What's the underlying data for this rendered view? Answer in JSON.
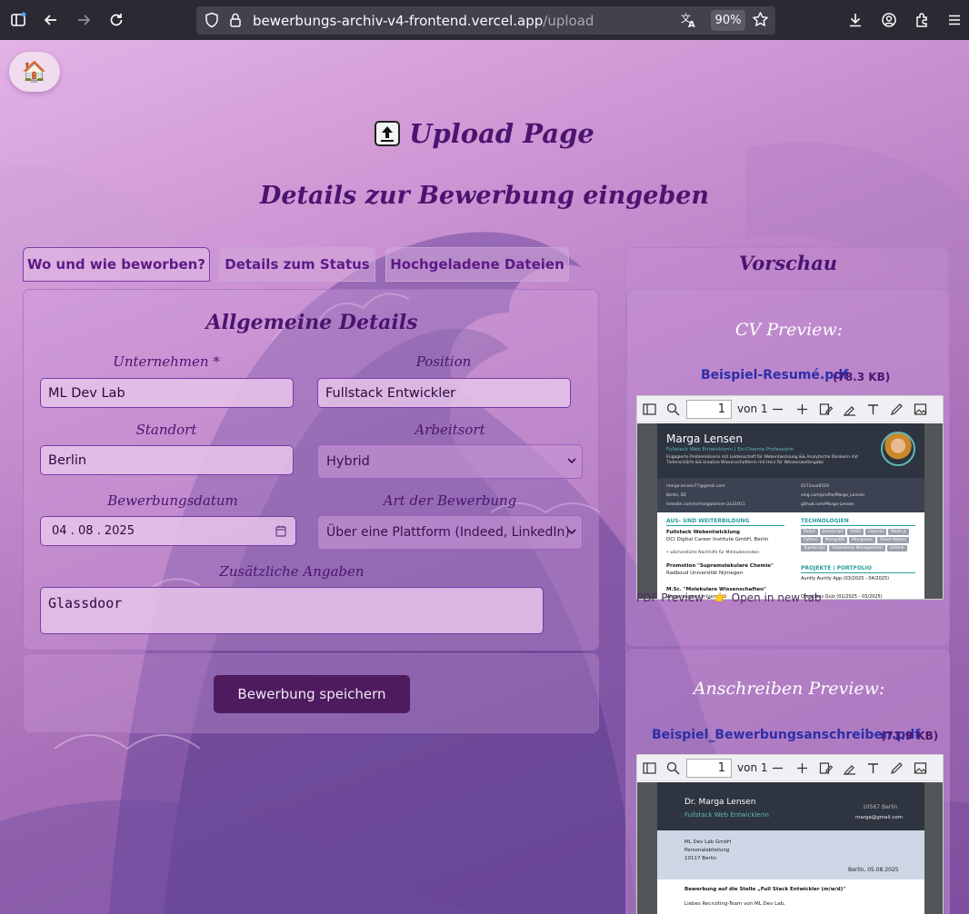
{
  "browser": {
    "url_host": "bewerbungs-archiv-v4-frontend.vercel.app",
    "url_path": "/upload",
    "zoom": "90%"
  },
  "page": {
    "home_icon": "🏠",
    "upload_title": "Upload Page",
    "details_title": "Details zur Bewerbung eingeben"
  },
  "tabs": [
    {
      "label": "Wo und wie beworben?",
      "active": true
    },
    {
      "label": "Details zum Status",
      "active": false
    },
    {
      "label": "Hochgeladene Dateien",
      "active": false
    }
  ],
  "form": {
    "heading": "Allgemeine Details",
    "company_label": "Unternehmen *",
    "company_value": "ML Dev Lab",
    "position_label": "Position",
    "position_value": "Fullstack Entwickler",
    "location_label": "Standort",
    "location_value": "Berlin",
    "worktype_label": "Arbeitsort",
    "worktype_value": "Hybrid",
    "date_label": "Bewerbungsdatum",
    "date_value": "04 . 08 . 2025",
    "apptype_label": "Art der Bewerbung",
    "apptype_value": "Über eine Plattform (Indeed, LinkedIn)",
    "extra_label": "Zusätzliche Angaben",
    "extra_value": "Glassdoor",
    "save_label": "Bewerbung speichern"
  },
  "preview": {
    "title": "Vorschau",
    "cv": {
      "title": "CV Preview:",
      "filename": "Beispiel-Resumé.pdf",
      "size": "(78.3 KB)",
      "page": "1",
      "of_pages": "von 1",
      "note": "PDF Preview - 👉 Open in new tab",
      "doc_name": "Marga Lensen",
      "doc_role": "Fullstack Web Entwicklerin | Ex-Chemie Professorin",
      "doc_tagline_1": "Engagierte Problemlöserin mit Leidenschaft für Webentwicklung && Analytische Denkerin mit",
      "doc_tagline_2": "Tiefenschärfe && kreative Wissenschaftlerin mit Herz für Wissensweitergabe",
      "doc_email": "marga.lensen77@gmail.com",
      "doc_city": "Berlin, DE",
      "doc_linkedin": "linkedin.com/in/margalensen-2a31911",
      "doc_phone": "0172xxx6319",
      "doc_xing": "xing.com/profile/Marga_Lensen",
      "doc_github": "github.com/Marga-Lensen",
      "doc_sec_edu": "AUS- UND WEITERBILDUNG",
      "doc_edu1": "Fullstack Webentwicklung",
      "doc_edu1_org": "DCI Digital Career Institute GmbH, Berlin",
      "doc_edu1_note": "• wöchentliche Nachhilfe für Mitstudierenden",
      "doc_edu2": "Promotion \"Supramolekulare Chemie\"",
      "doc_edu2_org": "Radboud Universität Nijmegen",
      "doc_edu3": "M.Sc. \"Molekulare Wissenschaften\"",
      "doc_edu3_org": "Wageningen Universität",
      "doc_sec_tech": "TECHNOLOGIEN",
      "doc_tech": [
        "React",
        "JavaScript",
        "SASS",
        "express",
        "Node.js",
        "Python",
        "MongoDB",
        "Mongoose",
        "React Native",
        "TypeScript",
        "Datenbank Management",
        "GitHub"
      ],
      "doc_sec_proj": "PROJEKTE | PORTFOLIO",
      "doc_proj1": "Auntly Auntly App (03/2025 - 04/2025)",
      "doc_proj2": "Questions Quiz (01/2025 - 03/2025)"
    },
    "letter": {
      "title": "Anschreiben Preview:",
      "filename": "Beispiel_Bewerbungsanschreiben.pdf",
      "size": "(71.9 KB)",
      "page": "1",
      "of_pages": "von 1",
      "doc_name": "Dr. Marga Lensen",
      "doc_role": "Fullstack Web Entwicklerin",
      "doc_zip": "10567 Berlin",
      "doc_mail": "marga@gmail.com",
      "doc_addr1": "ML Dev Lab GmbH",
      "doc_addr2": "Personalabteilung",
      "doc_addr3": "10117 Berlin",
      "doc_date": "Berlin, 05.08.2025",
      "doc_subject": "Bewerbung auf die Stelle „Full Stack Entwickler (m/w/d)\"",
      "doc_greeting": "Liebes Recruiting-Team von ML Dev Lab,"
    }
  }
}
